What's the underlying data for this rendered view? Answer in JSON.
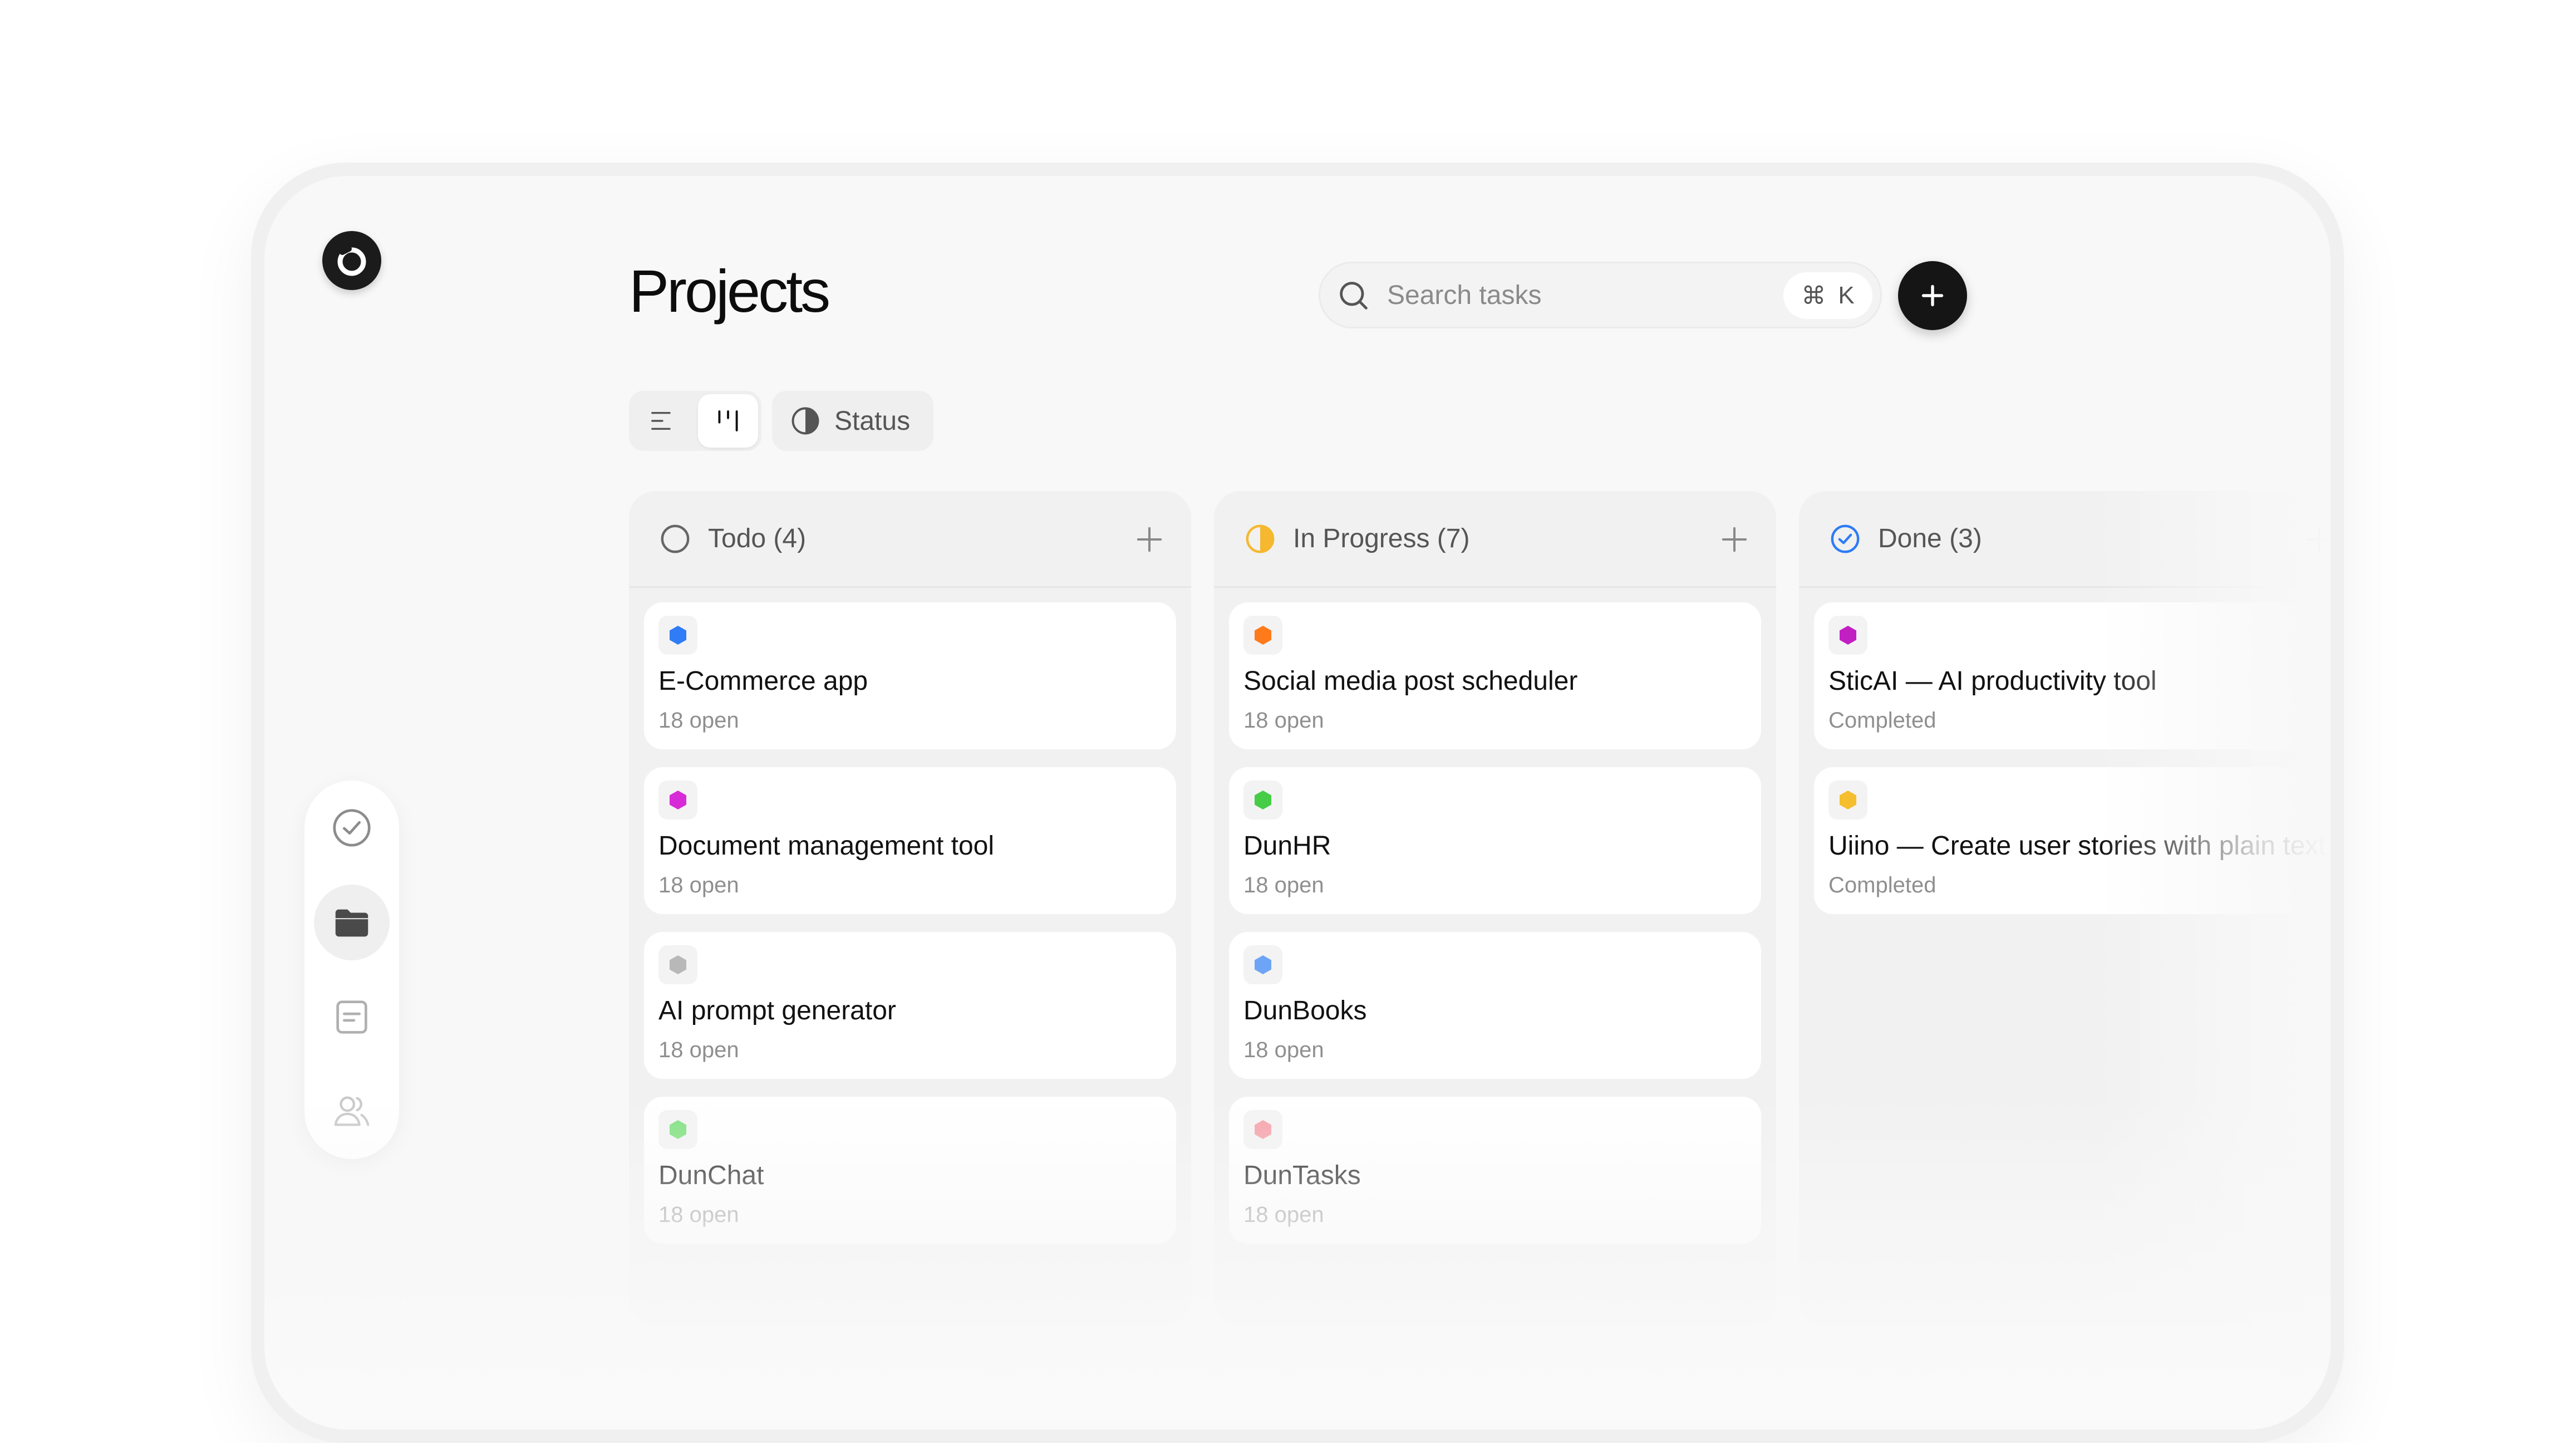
{
  "header": {
    "title": "Projects",
    "search_placeholder": "Search tasks",
    "shortcut_symbol": "⌘",
    "shortcut_key": "K"
  },
  "toolbar": {
    "status_label": "Status"
  },
  "icons": {
    "logo": "logo-icon",
    "nav": [
      "check-circle-icon",
      "folder-icon",
      "document-icon",
      "users-icon"
    ],
    "list_view": "list-view-icon",
    "board_view": "board-view-icon",
    "status": "half-circle-icon",
    "add": "plus-icon"
  },
  "colors": {
    "accent_dark": "#151515",
    "in_progress": "#f5b82e",
    "done": "#2f7cf6"
  },
  "columns": [
    {
      "label": "Todo (4)",
      "cards": [
        {
          "title": "E-Commerce app",
          "subtitle": "18 open",
          "color": "#2f7cf6"
        },
        {
          "title": "Document management tool",
          "subtitle": "18 open",
          "color": "#d62bd6"
        },
        {
          "title": "AI prompt generator",
          "subtitle": "18 open",
          "color": "#b8b8b8"
        },
        {
          "title": "DunChat",
          "subtitle": "18 open",
          "color": "#7ee07e"
        }
      ]
    },
    {
      "label": "In Progress (7)",
      "cards": [
        {
          "title": "Social media post scheduler",
          "subtitle": "18 open",
          "color": "#ff7a1a"
        },
        {
          "title": "DunHR",
          "subtitle": "18 open",
          "color": "#46cc46"
        },
        {
          "title": "DunBooks",
          "subtitle": "18 open",
          "color": "#6ea4f5"
        },
        {
          "title": "DunTasks",
          "subtitle": "18 open",
          "color": "#f5a0a8"
        }
      ]
    },
    {
      "label": "Done (3)",
      "cards": [
        {
          "title": "SticAI — AI productivity tool",
          "subtitle": "Completed",
          "color": "#c21fc2"
        },
        {
          "title": "Uiino — Create user stories with plain text",
          "subtitle": "Completed",
          "color": "#f5be2e"
        }
      ]
    }
  ]
}
